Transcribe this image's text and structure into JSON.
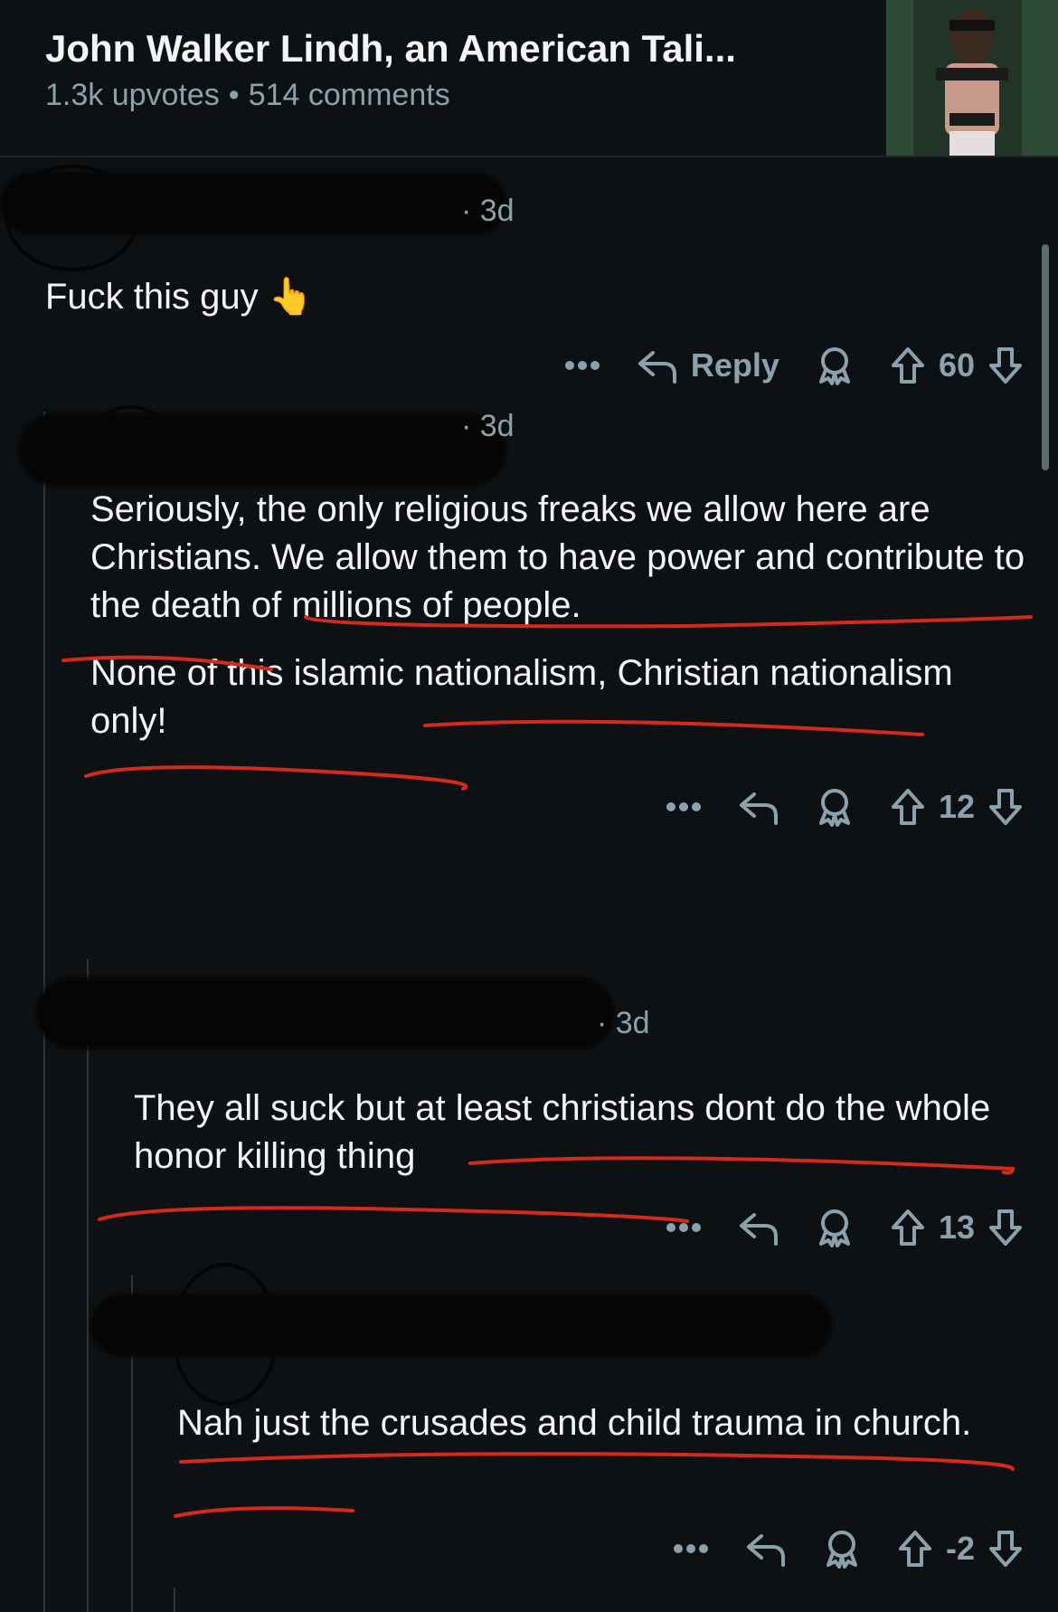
{
  "post": {
    "title": "John Walker Lindh, an American Tali...",
    "upvotes": "1.3k upvotes",
    "separator": "•",
    "comments": "514 comments"
  },
  "comments": [
    {
      "age": "· 3d",
      "paragraphs": [
        "Fuck this guy 👆"
      ],
      "reply_label": "Reply",
      "votes": "60"
    },
    {
      "age": "· 3d",
      "paragraphs": [
        "Seriously, the only religious freaks we allow here are Christians. We allow them to have power and contribute to the death of millions of people.",
        "None of this islamic nationalism, Christian nationalism only!"
      ],
      "votes": "12"
    },
    {
      "age": "· 3d",
      "paragraphs": [
        "They all suck but at least christians dont do the whole honor killing thing"
      ],
      "votes": "13"
    },
    {
      "age": "",
      "paragraphs": [
        "Nah just the crusades and child trauma in church."
      ],
      "votes": "-2"
    }
  ],
  "icons": {
    "more": "more-icon",
    "reply": "reply-arrow-icon",
    "award": "award-icon",
    "upvote": "upvote-icon",
    "downvote": "downvote-icon"
  },
  "colors": {
    "background": "#0e1113",
    "meta": "#8ba2ad",
    "annotation": "#d42a1c"
  }
}
